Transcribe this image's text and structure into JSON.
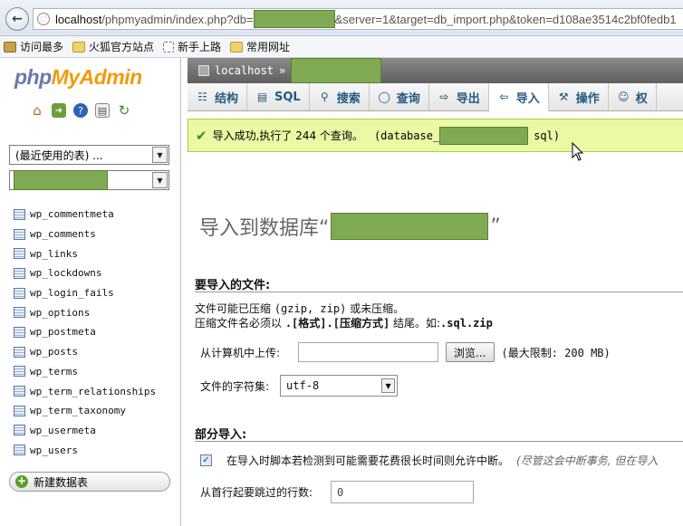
{
  "browser": {
    "url_prefix": "localhost",
    "url_path_before": "/phpmyadmin/index.php?db=",
    "url_path_after": "&server=1&target=db_import.php&token=d108ae3514c2bf0fedb1",
    "bookmarks": [
      {
        "label": "访问最多",
        "icon": "gear-icon"
      },
      {
        "label": "火狐官方站点",
        "icon": "folder-icon"
      },
      {
        "label": "新手上路",
        "icon": "page-icon"
      },
      {
        "label": "常用网址",
        "icon": "folder-icon"
      }
    ]
  },
  "sidebar": {
    "logo_php": "php",
    "logo_myadmin": "MyAdmin",
    "recent_select": "(最近使用的表) ...",
    "tables": [
      "wp_commentmeta",
      "wp_comments",
      "wp_links",
      "wp_lockdowns",
      "wp_login_fails",
      "wp_options",
      "wp_postmeta",
      "wp_posts",
      "wp_terms",
      "wp_term_relationships",
      "wp_term_taxonomy",
      "wp_usermeta",
      "wp_users"
    ],
    "new_db": "新建数据表"
  },
  "main": {
    "breadcrumb_server": "localhost",
    "breadcrumb_sep": "»",
    "tabs": [
      {
        "label": "结构",
        "icon": "structure-icon"
      },
      {
        "label": "SQL",
        "icon": "sql-icon"
      },
      {
        "label": "搜索",
        "icon": "search-icon"
      },
      {
        "label": "查询",
        "icon": "query-icon"
      },
      {
        "label": "导出",
        "icon": "export-icon"
      },
      {
        "label": "导入",
        "icon": "import-icon"
      },
      {
        "label": "操作",
        "icon": "wrench-icon"
      },
      {
        "label": "权",
        "icon": "privileges-icon"
      }
    ],
    "active_tab": "导入",
    "success_msg": "导入成功,执行了 244 个查询。",
    "success_file_prefix": "(database_",
    "success_file_suffix": "sql)",
    "heading_prefix": "导入到数据库“",
    "heading_suffix": "”",
    "section_file": "要导入的文件:",
    "note_line1_a": "文件可能已压缩 ",
    "note_line1_b": "(gzip, zip)",
    "note_line1_c": " 或未压缩。",
    "note_line2_a": "压缩文件名必须以 ",
    "note_line2_b": ".[格式].[压缩方式]",
    "note_line2_c": " 结尾。如:",
    "note_line2_d": ".sql.zip",
    "upload_label": "从计算机中上传:",
    "browse_label": "浏览...",
    "max_limit": "(最大限制: 200 MB)",
    "charset_label": "文件的字符集:",
    "charset_value": "utf-8",
    "section_partial": "部分导入:",
    "partial_checkbox_label": "在导入时脚本若检测到可能需要花费很长时间则允许中断。",
    "partial_hint": "(尽管这会中断事务, 但在导入",
    "skip_label": "从首行起要跳过的行数:",
    "skip_value": "0"
  }
}
